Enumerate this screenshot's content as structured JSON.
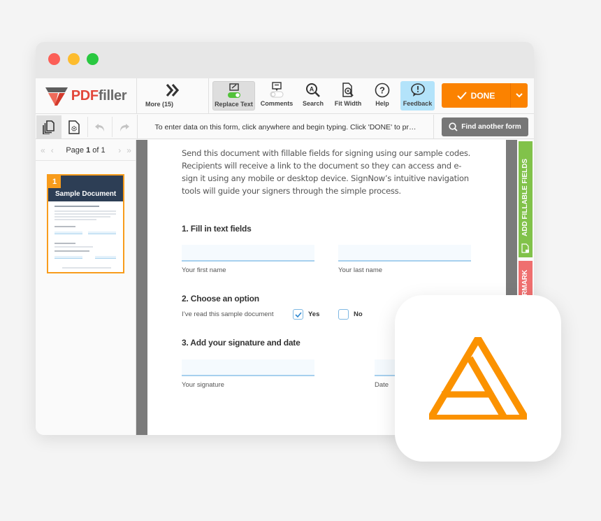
{
  "window": {
    "traffic_lights": [
      "close",
      "minimize",
      "maximize"
    ]
  },
  "toolbar": {
    "logo": {
      "pdf": "PDF",
      "filler": "filler"
    },
    "more_label": "More (15)",
    "tools": [
      {
        "id": "replace-text",
        "label": "Replace Text",
        "icon": "replace-text-toggle-icon",
        "active": true,
        "toggle_on": true
      },
      {
        "id": "comments",
        "label": "Comments",
        "icon": "comment-toggle-icon",
        "active": false,
        "toggle_on": false
      },
      {
        "id": "search",
        "label": "Search",
        "icon": "search-icon"
      },
      {
        "id": "fit-width",
        "label": "Fit Width",
        "icon": "fit-width-icon"
      },
      {
        "id": "help",
        "label": "Help",
        "icon": "help-icon"
      },
      {
        "id": "feedback",
        "label": "Feedback",
        "icon": "feedback-icon",
        "highlight": "#b3e3fa"
      }
    ],
    "done_label": "DONE",
    "done_color": "#fb8200"
  },
  "subbar": {
    "hint": "To enter data on this form, click anywhere and begin typing. Click 'DONE' to pr…",
    "find_label": "Find another form"
  },
  "sidebar": {
    "page_label_prefix": "Page ",
    "current_page": "1",
    "page_label_mid": " of ",
    "total_pages": "1",
    "thumbnail": {
      "number": "1",
      "title": "Sample Document"
    }
  },
  "document": {
    "intro": "Send this document with fillable fields for signing using our sample codes. Recipients will receive a link to the document so they can access and e-sign it using any mobile or desktop device. SignNow’s intuitive navigation tools will guide your signers through the simple process.",
    "section1": "1. Fill in text fields",
    "first_name_label": "Your first name",
    "last_name_label": "Your last name",
    "first_name_value": "",
    "last_name_value": "",
    "section2": "2. Choose an option",
    "option_prompt": "I’ve read this sample document",
    "yes_label": "Yes",
    "no_label": "No",
    "yes_checked": true,
    "no_checked": false,
    "section3": "3. Add your signature and date",
    "signature_label": "Your signature",
    "date_label": "Date"
  },
  "right_tabs": [
    {
      "label": "ADD FILLABLE FIELDS",
      "color": "#81c24a"
    },
    {
      "label": "RMARK",
      "color": "#ef6f6f"
    }
  ],
  "app_icon": {
    "name": "airslate-triangle-logo",
    "color": "#fb9200"
  }
}
